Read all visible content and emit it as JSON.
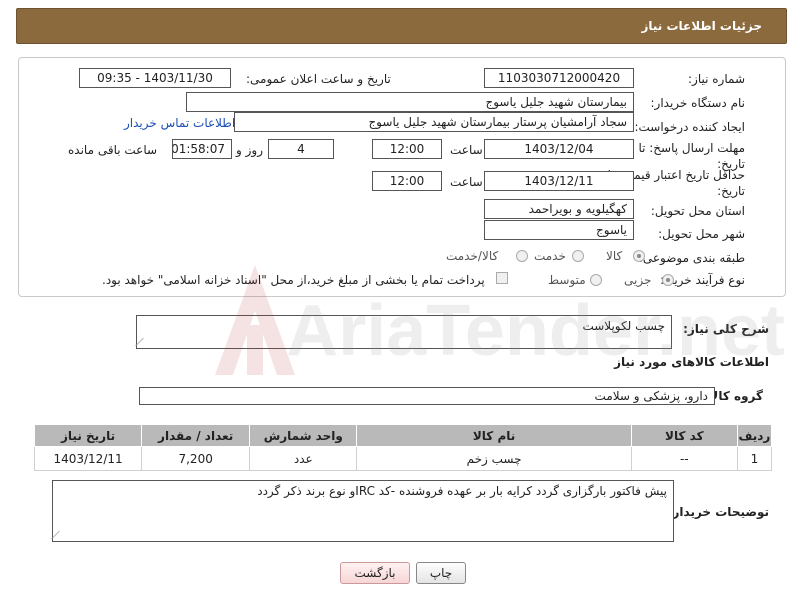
{
  "header": {
    "title": "جزئیات اطلاعات نیاز"
  },
  "form": {
    "need_number": {
      "label": "شماره نیاز:",
      "value": "1103030712000420"
    },
    "announce_datetime": {
      "label": "تاریخ و ساعت اعلان عمومی:",
      "value": "1403/11/30 - 09:35"
    },
    "buyer_org": {
      "label": "نام دستگاه خریدار:",
      "value": "بیمارستان شهید جلیل یاسوج"
    },
    "requester": {
      "label": "ایجاد کننده درخواست:",
      "value": "سجاد آرامشیان پرستار بیمارستان شهید جلیل یاسوج",
      "contact_link": "اطلاعات تماس خریدار"
    },
    "reply_deadline": {
      "label": "مهلت ارسال پاسخ: تا تاریخ:",
      "date": "1403/12/04",
      "time_label": "ساعت",
      "time": "12:00",
      "days": "4",
      "days_label": "روز و",
      "remaining": "01:58:07",
      "remaining_label": "ساعت باقی مانده"
    },
    "price_validity": {
      "label": "حداقل تاریخ اعتبار قیمت: تا تاریخ:",
      "date": "1403/12/11",
      "time_label": "ساعت",
      "time": "12:00"
    },
    "province": {
      "label": "استان محل تحویل:",
      "value": "کهگیلویه و بویراحمد"
    },
    "city": {
      "label": "شهر محل تحویل:",
      "value": "یاسوج"
    },
    "category": {
      "label": "طبقه بندی موضوعی:",
      "options": [
        "کالا",
        "خدمت",
        "کالا/خدمت"
      ],
      "selected": "کالا"
    },
    "purchase_type": {
      "label": "نوع فرآیند خرید :",
      "options": [
        "جزیی",
        "متوسط"
      ],
      "selected": "جزیی",
      "payment_note": "پرداخت تمام یا بخشی از مبلغ خرید،از محل \"اسناد خزانه اسلامی\" خواهد بود."
    }
  },
  "summary": {
    "label": "شرح کلی نیاز:",
    "value": "چسب لکوپلاست"
  },
  "goods_section_title": "اطلاعات کالاهای مورد نیاز",
  "goods_group": {
    "label": "گروه کالا:",
    "value": "دارو، پزشکی و سلامت"
  },
  "table": {
    "headers": [
      "ردیف",
      "کد کالا",
      "نام کالا",
      "واحد شمارش",
      "تعداد / مقدار",
      "تاریخ نیاز"
    ],
    "rows": [
      [
        "1",
        "--",
        "چسب زخم",
        "عدد",
        "7,200",
        "1403/12/11"
      ]
    ]
  },
  "buyer_notes": {
    "label": "توضیحات خریدار:",
    "value": "پیش فاکتور بارگزاری گردد کرایه بار بر عهده فروشنده -کد IRCو نوع برند ذکر گردد"
  },
  "buttons": {
    "print": "چاپ",
    "back": "بازگشت"
  },
  "watermark": {
    "text": "AriaTender.net"
  },
  "colors": {
    "header_bg": "#8b6b3e",
    "table_header_bg": "#b9b9b9",
    "link": "#1b4fb3"
  }
}
